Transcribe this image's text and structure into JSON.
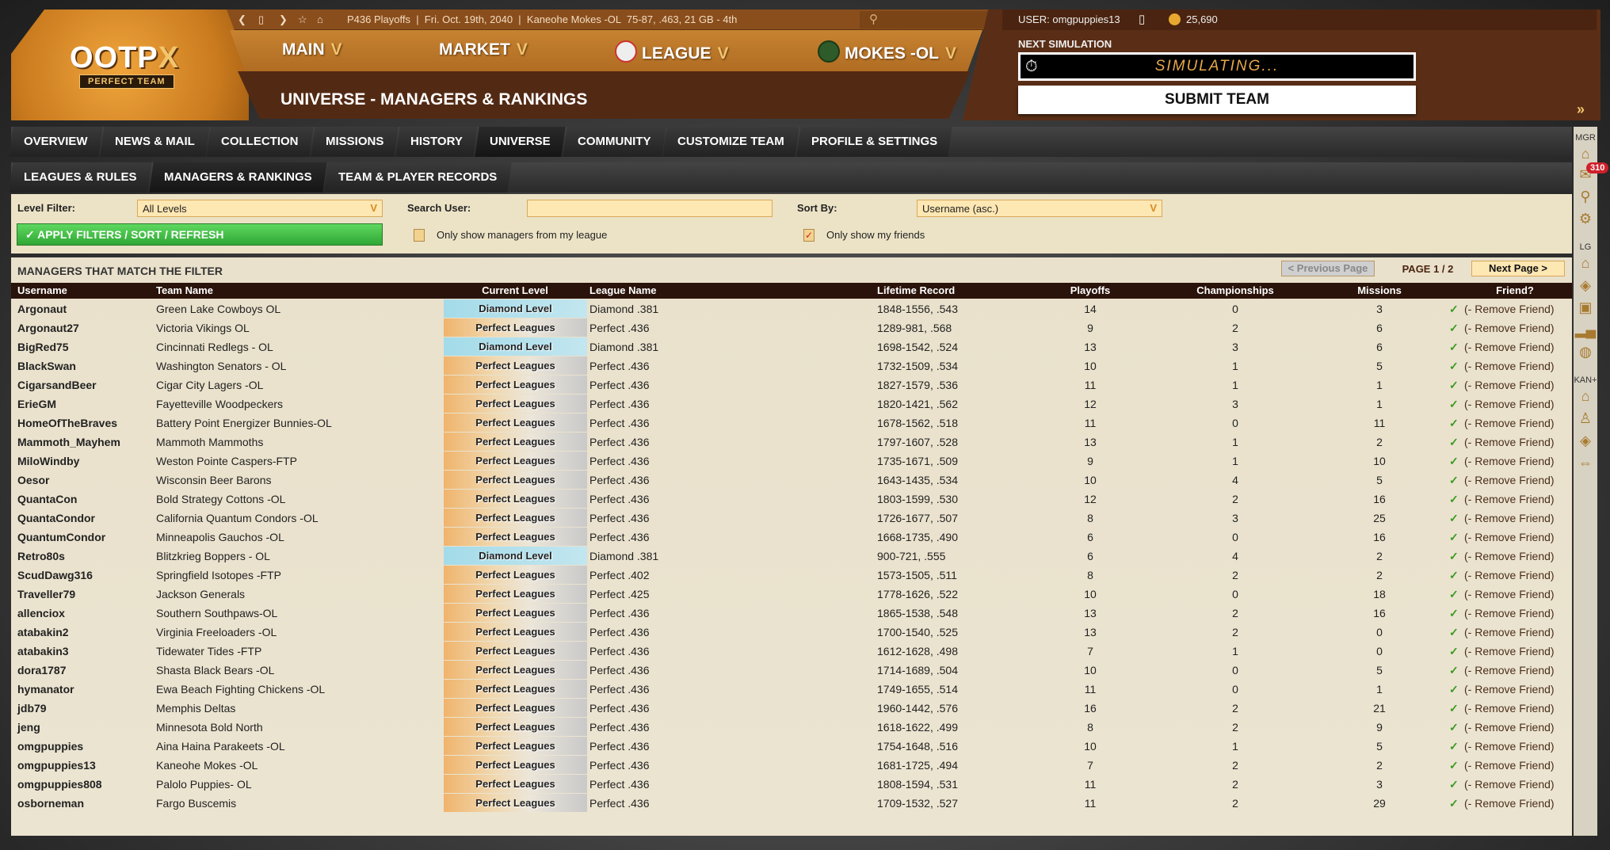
{
  "logo": {
    "text": "OOTP",
    "suffix": "X",
    "sub": "PERFECT TEAM"
  },
  "topbar": {
    "status": "P436 Playoffs  |  Fri. Oct. 19th, 2040  |  Kaneohe Mokes -OL  75-87, .463, 21 GB - 4th"
  },
  "menu": [
    {
      "label": "MAIN"
    },
    {
      "label": "MARKET"
    },
    {
      "label": "LEAGUE"
    },
    {
      "label": "MOKES -OL"
    }
  ],
  "page_title": "UNIVERSE - MANAGERS & RANKINGS",
  "user": {
    "label": "USER: omgpuppies13",
    "points": "25,690"
  },
  "sim": {
    "label": "NEXT SIMULATION",
    "status": "SIMULATING...",
    "submit": "SUBMIT TEAM"
  },
  "tabs": [
    "OVERVIEW",
    "NEWS & MAIL",
    "COLLECTION",
    "MISSIONS",
    "HISTORY",
    "UNIVERSE",
    "COMMUNITY",
    "CUSTOMIZE TEAM",
    "PROFILE & SETTINGS"
  ],
  "subtabs": [
    "LEAGUES & RULES",
    "MANAGERS & RANKINGS",
    "TEAM & PLAYER RECORDS"
  ],
  "filters": {
    "level_label": "Level Filter:",
    "level_value": "All Levels",
    "search_label": "Search User:",
    "search_value": "",
    "sort_label": "Sort By:",
    "sort_value": "Username (asc.)",
    "apply": "✓ APPLY FILTERS / SORT / REFRESH",
    "only_league": "Only show managers from my league",
    "only_league_checked": false,
    "only_friends": "Only show my friends",
    "only_friends_checked": true
  },
  "table": {
    "title": "MANAGERS THAT MATCH THE FILTER",
    "prev": "< Previous Page",
    "page": "PAGE 1 / 2",
    "next": "Next Page >",
    "columns": [
      "Username",
      "Team Name",
      "Current Level",
      "League Name",
      "Lifetime Record",
      "Playoffs",
      "Championships",
      "Missions",
      "Friend?"
    ],
    "remove_label": "(- Remove Friend)",
    "rows": [
      [
        "Argonaut",
        "Green Lake Cowboys OL",
        "Diamond Level",
        "Diamond .381",
        "1848-1556, .543",
        "14",
        "0",
        "3"
      ],
      [
        "Argonaut27",
        "Victoria Vikings OL",
        "Perfect Leagues",
        "Perfect .436",
        "1289-981, .568",
        "9",
        "2",
        "6"
      ],
      [
        "BigRed75",
        "Cincinnati Redlegs   - OL",
        "Diamond Level",
        "Diamond .381",
        "1698-1542, .524",
        "13",
        "3",
        "6"
      ],
      [
        "BlackSwan",
        "Washington Senators - OL",
        "Perfect Leagues",
        "Perfect .436",
        "1732-1509, .534",
        "10",
        "1",
        "5"
      ],
      [
        "CigarsandBeer",
        "Cigar City Lagers -OL",
        "Perfect Leagues",
        "Perfect .436",
        "1827-1579, .536",
        "11",
        "1",
        "1"
      ],
      [
        "ErieGM",
        "Fayetteville Woodpeckers",
        "Perfect Leagues",
        "Perfect .436",
        "1820-1421, .562",
        "12",
        "3",
        "1"
      ],
      [
        "HomeOfTheBraves",
        "Battery Point Energizer Bunnies-OL",
        "Perfect Leagues",
        "Perfect .436",
        "1678-1562, .518",
        "11",
        "0",
        "11"
      ],
      [
        "Mammoth_Mayhem",
        "Mammoth Mammoths",
        "Perfect Leagues",
        "Perfect .436",
        "1797-1607, .528",
        "13",
        "1",
        "2"
      ],
      [
        "MiloWindby",
        "Weston Pointe Caspers-FTP",
        "Perfect Leagues",
        "Perfect .436",
        "1735-1671, .509",
        "9",
        "1",
        "10"
      ],
      [
        "Oesor",
        "Wisconsin Beer Barons",
        "Perfect Leagues",
        "Perfect .436",
        "1643-1435, .534",
        "10",
        "4",
        "5"
      ],
      [
        "QuantaCon",
        "Bold Strategy Cottons -OL",
        "Perfect Leagues",
        "Perfect .436",
        "1803-1599, .530",
        "12",
        "2",
        "16"
      ],
      [
        "QuantaCondor",
        "California Quantum Condors -OL",
        "Perfect Leagues",
        "Perfect .436",
        "1726-1677, .507",
        "8",
        "3",
        "25"
      ],
      [
        "QuantumCondor",
        "Minneapolis Gauchos -OL",
        "Perfect Leagues",
        "Perfect .436",
        "1668-1735, .490",
        "6",
        "0",
        "16"
      ],
      [
        "Retro80s",
        "Blitzkrieg Boppers - OL",
        "Diamond Level",
        "Diamond .381",
        "900-721, .555",
        "6",
        "4",
        "2"
      ],
      [
        "ScudDawg316",
        "Springfield Isotopes -FTP",
        "Perfect Leagues",
        "Perfect .402",
        "1573-1505, .511",
        "8",
        "2",
        "2"
      ],
      [
        "Traveller79",
        "Jackson Generals",
        "Perfect Leagues",
        "Perfect .425",
        "1778-1626, .522",
        "10",
        "0",
        "18"
      ],
      [
        "allenciox",
        "Southern Southpaws-OL",
        "Perfect Leagues",
        "Perfect .436",
        "1865-1538, .548",
        "13",
        "2",
        "16"
      ],
      [
        "atabakin2",
        "Virginia Freeloaders  -OL",
        "Perfect Leagues",
        "Perfect .436",
        "1700-1540, .525",
        "13",
        "2",
        "0"
      ],
      [
        "atabakin3",
        "Tidewater Tides  -FTP",
        "Perfect Leagues",
        "Perfect .436",
        "1612-1628, .498",
        "7",
        "1",
        "0"
      ],
      [
        "dora1787",
        "Shasta Black Bears -OL",
        "Perfect Leagues",
        "Perfect .436",
        "1714-1689, .504",
        "10",
        "0",
        "5"
      ],
      [
        "hymanator",
        "Ewa Beach Fighting Chickens -OL",
        "Perfect Leagues",
        "Perfect .436",
        "1749-1655, .514",
        "11",
        "0",
        "1"
      ],
      [
        "jdb79",
        "Memphis Deltas",
        "Perfect Leagues",
        "Perfect .436",
        "1960-1442, .576",
        "16",
        "2",
        "21"
      ],
      [
        "jeng",
        "Minnesota Bold North",
        "Perfect Leagues",
        "Perfect .436",
        "1618-1622, .499",
        "8",
        "2",
        "9"
      ],
      [
        "omgpuppies",
        "Aina Haina Parakeets -OL",
        "Perfect Leagues",
        "Perfect .436",
        "1754-1648, .516",
        "10",
        "1",
        "5"
      ],
      [
        "omgpuppies13",
        "Kaneohe Mokes -OL",
        "Perfect Leagues",
        "Perfect .436",
        "1681-1725, .494",
        "7",
        "2",
        "2"
      ],
      [
        "omgpuppies808",
        "Palolo Puppies- OL",
        "Perfect Leagues",
        "Perfect .436",
        "1808-1594, .531",
        "11",
        "2",
        "3"
      ],
      [
        "osborneman",
        "Fargo Buscemis",
        "Perfect Leagues",
        "Perfect .436",
        "1709-1532, .527",
        "11",
        "2",
        "29"
      ]
    ]
  },
  "sidebar": {
    "mgr_label": "MGR",
    "lg_label": "LG",
    "kan_label": "KAN+",
    "mail_badge": "310"
  }
}
